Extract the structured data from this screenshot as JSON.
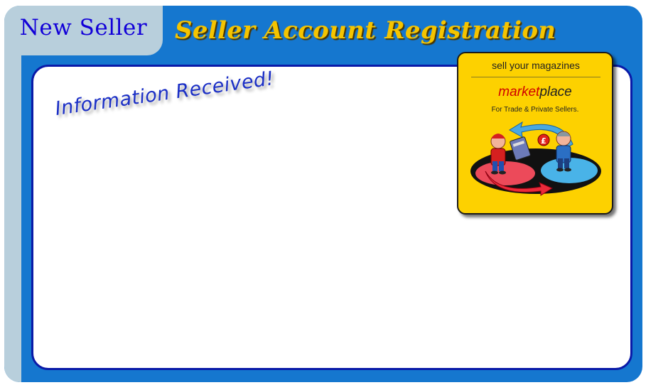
{
  "header": {
    "tab_label": "New Seller",
    "title": "Seller Account Registration"
  },
  "main": {
    "message": "Information Received!"
  },
  "ad": {
    "headline": "sell your magazines",
    "brand_part1": "market",
    "brand_part2": "place",
    "tagline": "For Trade & Private Sellers."
  },
  "colors": {
    "frame_blue": "#1577cf",
    "tab_gray_blue": "#b8cfdc",
    "tab_text": "#1200d8",
    "title_gold": "#f5c400",
    "content_border": "#0a1aa8",
    "message_blue": "#1b2fc6",
    "ad_yellow": "#fdd100"
  }
}
